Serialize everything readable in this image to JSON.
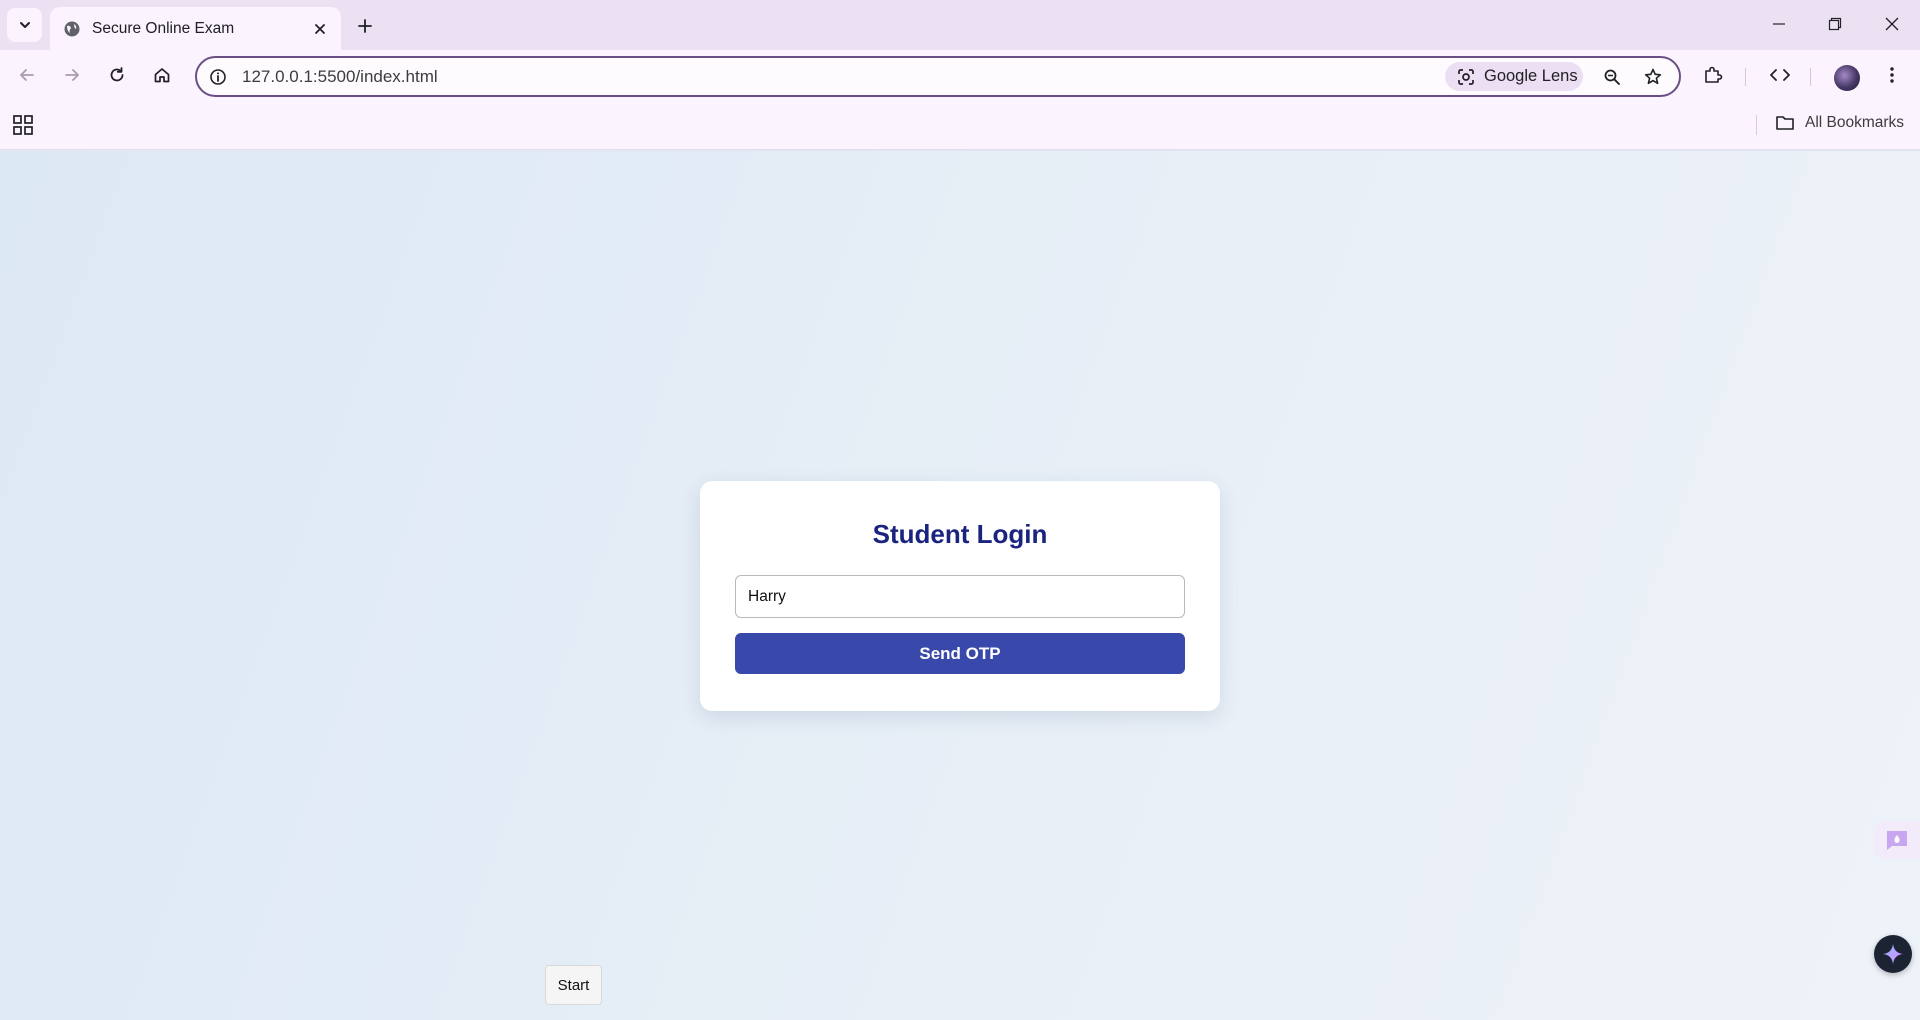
{
  "browser": {
    "tab_title": "Secure Online Exam",
    "url": "127.0.0.1:5500/index.html",
    "lens_label": "Google Lens",
    "all_bookmarks_label": "All Bookmarks",
    "accent_color": "#6b4e85"
  },
  "login": {
    "title": "Student Login",
    "name_value": "Harry",
    "send_otp_label": "Send OTP",
    "title_color": "#1a237e",
    "button_color": "#3949ab"
  },
  "start_button_label": "Start",
  "icons": {
    "tab_search": "chevron-down-icon",
    "favicon": "globe-icon",
    "tab_close": "close-icon",
    "new_tab": "plus-icon",
    "back": "arrow-left-icon",
    "forward": "arrow-right-icon",
    "reload": "reload-icon",
    "home": "home-icon",
    "site_info": "info-icon",
    "lens": "camera-lens-icon",
    "zoom": "zoom-icon",
    "bookmark": "star-icon",
    "extensions": "puzzle-icon",
    "devtools": "code-icon",
    "menu": "kebab-icon",
    "apps": "apps-grid-icon",
    "folder": "folder-icon",
    "side_panel": "chat-icon",
    "gemini": "sparkle-icon"
  }
}
